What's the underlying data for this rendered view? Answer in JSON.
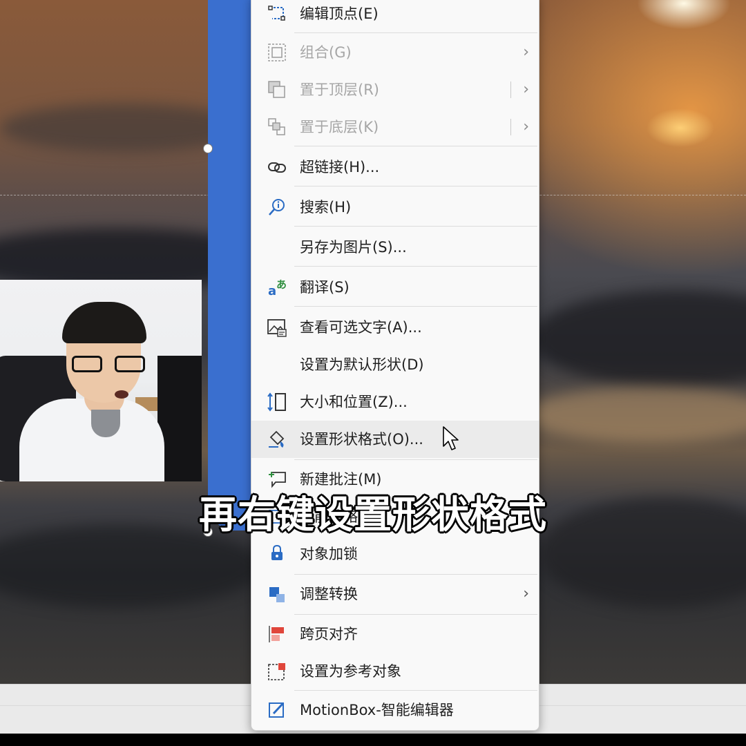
{
  "menu": {
    "items": [
      {
        "label": "编辑顶点(E)",
        "icon": "edit-points-icon",
        "disabled": false,
        "submenu": false
      },
      {
        "label": "组合(G)",
        "icon": "group-icon",
        "disabled": true,
        "submenu": true
      },
      {
        "label": "置于顶层(R)",
        "icon": "bring-to-front-icon",
        "disabled": true,
        "submenu": true,
        "split": true
      },
      {
        "label": "置于底层(K)",
        "icon": "send-to-back-icon",
        "disabled": true,
        "submenu": true,
        "split": true
      },
      {
        "label": "超链接(H)...",
        "icon": "link-icon",
        "disabled": false,
        "submenu": false
      },
      {
        "label": "搜索(H)",
        "icon": "search-icon",
        "disabled": false,
        "submenu": false
      },
      {
        "label": "另存为图片(S)...",
        "icon": "",
        "disabled": false,
        "submenu": false
      },
      {
        "label": "翻译(S)",
        "icon": "translate-icon",
        "disabled": false,
        "submenu": false
      },
      {
        "label": "查看可选文字(A)...",
        "icon": "alt-text-icon",
        "disabled": false,
        "submenu": false
      },
      {
        "label": "设置为默认形状(D)",
        "icon": "",
        "disabled": false,
        "submenu": false
      },
      {
        "label": "大小和位置(Z)...",
        "icon": "size-position-icon",
        "disabled": false,
        "submenu": false
      },
      {
        "label": "设置形状格式(O)...",
        "icon": "format-shape-icon",
        "disabled": false,
        "submenu": false,
        "hovered": true
      },
      {
        "label": "新建批注(M)",
        "icon": "new-comment-icon",
        "disabled": false,
        "submenu": false
      },
      {
        "label": "智能缩略图",
        "icon": "thumbnail-icon",
        "disabled": false,
        "submenu": false
      },
      {
        "label": "对象加锁",
        "icon": "lock-icon",
        "disabled": false,
        "submenu": false
      },
      {
        "label": "调整转换",
        "icon": "convert-icon",
        "disabled": false,
        "submenu": true
      },
      {
        "label": "跨页对齐",
        "icon": "cross-page-align-icon",
        "disabled": false,
        "submenu": false
      },
      {
        "label": "设置为参考对象",
        "icon": "reference-object-icon",
        "disabled": false,
        "submenu": false
      },
      {
        "label": "MotionBox-智能编辑器",
        "icon": "motionbox-icon",
        "disabled": false,
        "submenu": false
      }
    ],
    "chevron": "›"
  },
  "subtitle": "再右键设置形状格式",
  "colors": {
    "shape_fill": "#3a6fcf",
    "menu_bg": "#f9f9f9",
    "hover_bg": "#ebebeb",
    "icon_blue": "#2b6cc4",
    "icon_red": "#e0463b",
    "icon_green": "#2f8f3f"
  }
}
